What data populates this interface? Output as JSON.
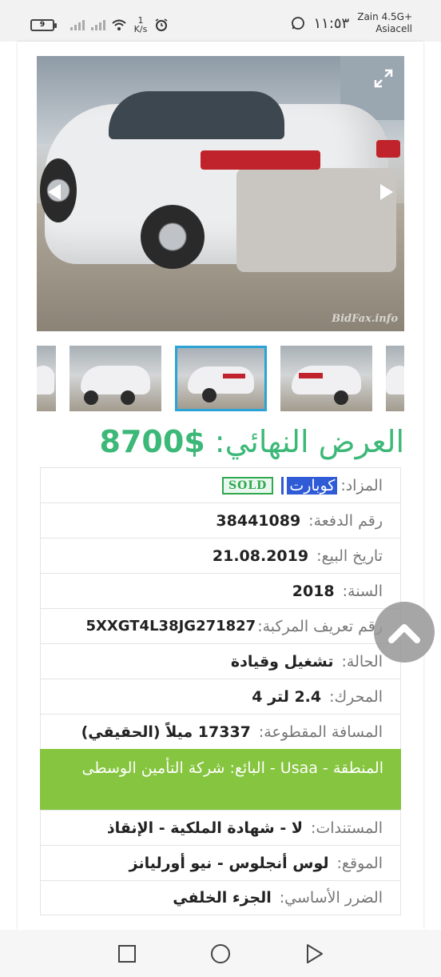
{
  "status_bar": {
    "battery": "9",
    "speed_value": "1",
    "speed_unit": "K/s",
    "time": "١١:٥٣",
    "carrier_line1": "Zain 4.5G+",
    "carrier_line2": "Asiacell"
  },
  "gallery": {
    "watermark": "BidFax.info",
    "icons": [
      "expand-icon",
      "arrow-left-icon",
      "arrow-right-icon"
    ]
  },
  "price": {
    "label": "العرض النهائي:",
    "value": "8700$"
  },
  "details": {
    "auction_label": "المزاد:",
    "auction_value": "كوبارت",
    "sold_badge": "SOLD",
    "lot_label": "رقم الدفعة:",
    "lot_value": "38441089",
    "sale_date_label": "تاريخ البيع:",
    "sale_date_value": "21.08.2019",
    "year_label": "السنة:",
    "year_value": "2018",
    "vin_label": "رقم تعريف المركبة:",
    "vin_value": "5XXGT4L38JG271827",
    "condition_label": "الحالة:",
    "condition_value": "تشغيل وقيادة",
    "engine_label": "المحرك:",
    "engine_value": "2.4 لتر 4",
    "mileage_label": "المسافة المقطوعة:",
    "mileage_value": "17337 ميلاً (الحقيقي)",
    "seller_region_text": "المنطقة - Usaa - البائع: شركة التأمين الوسطى",
    "documents_label": "المستندات:",
    "documents_value": "لا - شهادة الملكية - الإنقاذ",
    "location_label": "الموقع:",
    "location_value": "لوس أنجلوس - نيو أورليانز",
    "damage_label": "الضرر الأساسي:",
    "damage_value": "الجزء الخلفي"
  },
  "colors": {
    "price_green": "#3cb878",
    "seller_bar_green": "#86c53f",
    "active_thumb_border": "#2aa3d6",
    "selection_blue": "#2f5bd6"
  },
  "navigation": {
    "icons": [
      "recent-apps-icon",
      "home-icon",
      "back-icon"
    ]
  }
}
